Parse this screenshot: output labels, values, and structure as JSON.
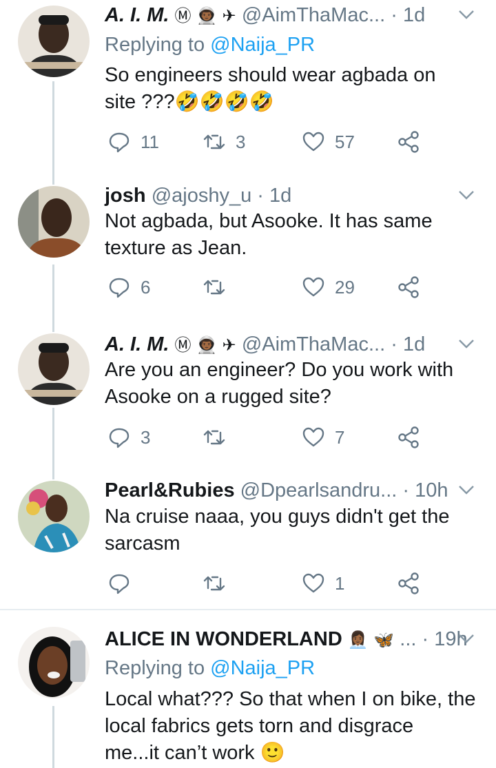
{
  "tweets": [
    {
      "name": "A. I. M.",
      "badges": "Ⓜ 👨🏾‍🚀 ✈",
      "handle": "@AimThaMac...",
      "time": "1d",
      "replying_prefix": "Replying to",
      "replying_to": "@Naija_PR",
      "text_line1": "So engineers should wear agbada on",
      "text_line2": "site ???🤣🤣🤣🤣",
      "replies": "11",
      "retweets": "3",
      "likes": "57"
    },
    {
      "name": "josh",
      "handle": "@ajoshy_u",
      "time": "1d",
      "text_line1": "Not agbada, but Asooke. It has same",
      "text_line2": "texture as Jean.",
      "replies": "6",
      "retweets": "",
      "likes": "29"
    },
    {
      "name": "A. I. M.",
      "badges": "Ⓜ 👨🏾‍🚀 ✈",
      "handle": "@AimThaMac...",
      "time": "1d",
      "text_line1": "Are you an engineer? Do you work with",
      "text_line2": "Asooke on a rugged site?",
      "replies": "3",
      "retweets": "",
      "likes": "7"
    },
    {
      "name": "Pearl&Rubies",
      "handle": "@Dpearlsandru...",
      "time": "10h",
      "text_line1": "Na cruise naaa, you guys didn't get the",
      "text_line2": "sarcasm",
      "replies": "",
      "retweets": "",
      "likes": "1"
    },
    {
      "name": "ALICE IN WONDERLAND",
      "badges": "👩🏾‍💼 🦋",
      "handle": "...",
      "time": "19h",
      "replying_prefix": "Replying to",
      "replying_to": "@Naija_PR",
      "text_line1": "Local what??? So that when I on bike, the",
      "text_line2": "local fabrics gets torn and disgrace",
      "text_line3": "me...it can’t work 🙂"
    }
  ],
  "colors": {
    "secondary": "#657786",
    "link": "#1da1f2",
    "line": "#cfd9de"
  }
}
